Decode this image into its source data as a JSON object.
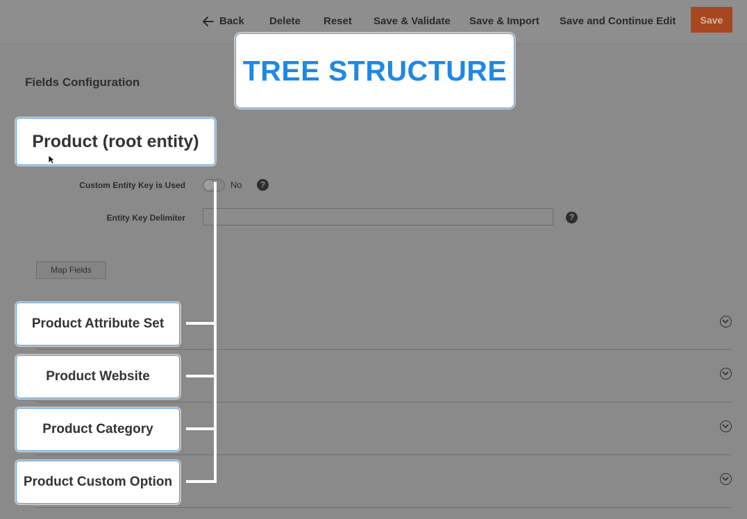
{
  "toolbar": {
    "back": "Back",
    "delete": "Delete",
    "reset": "Reset",
    "save_validate": "Save & Validate",
    "save_import": "Save & Import",
    "save_continue": "Save and Continue Edit",
    "save": "Save"
  },
  "section_title": "Fields Configuration",
  "callouts": {
    "tree_structure": "TREE STRUCTURE",
    "root": "Product (root entity)",
    "children": [
      "Product Attribute Set",
      "Product Website",
      "Product Category",
      "Product Custom Option"
    ]
  },
  "fields": {
    "custom_key_label": "Custom Entity Key is Used",
    "custom_key_toggle_text": "No",
    "delimiter_label": "Entity Key Delimiter",
    "delimiter_value": ""
  },
  "map_fields": "Map Fields",
  "help_glyph": "?",
  "colors": {
    "accent_title": "#1e88e5",
    "save_button": "#a8461f"
  }
}
